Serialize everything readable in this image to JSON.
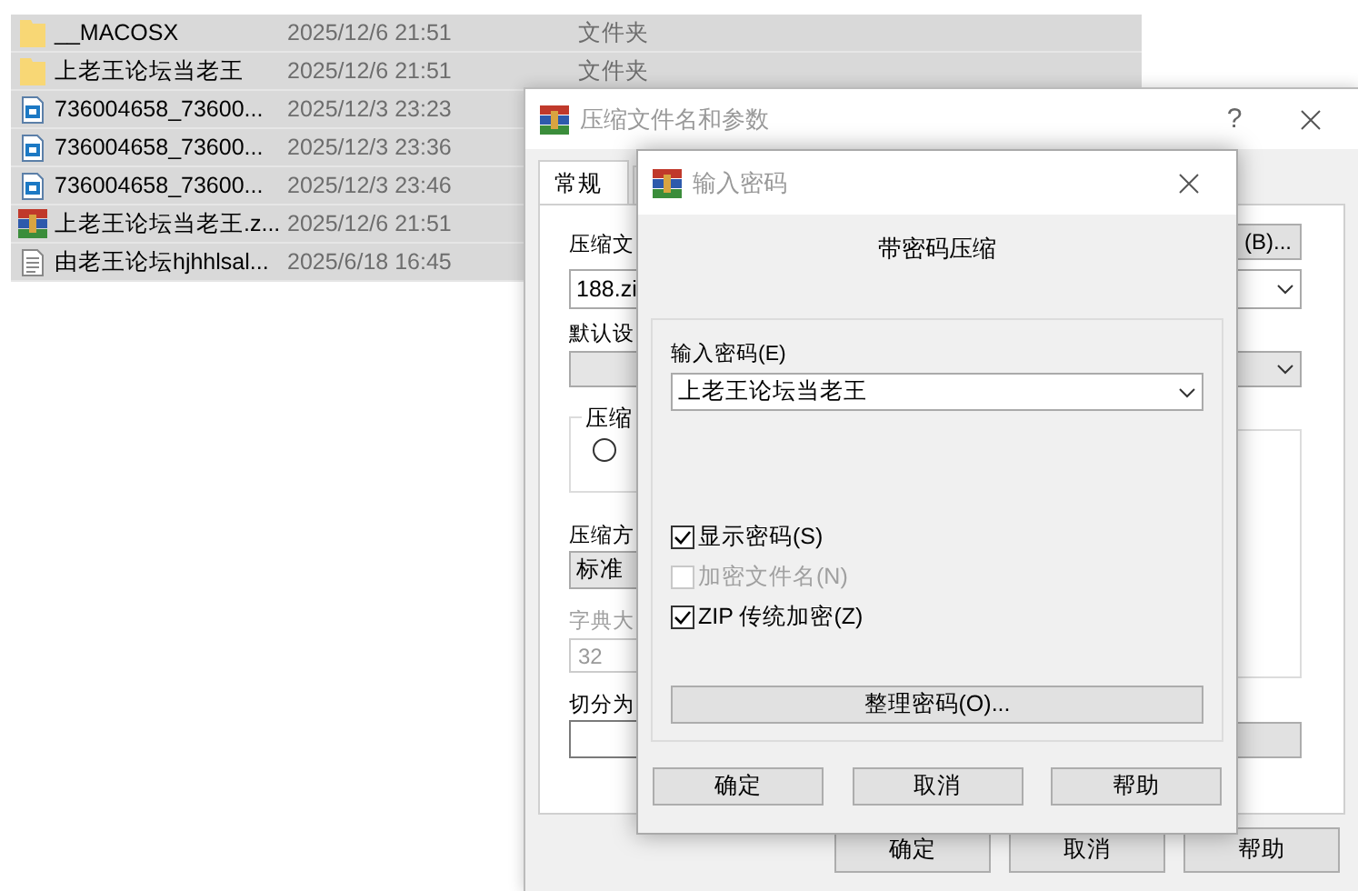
{
  "files": [
    {
      "kind": "folder",
      "name": "__MACOSX",
      "date": "2025/12/6 21:51",
      "type": "文件夹"
    },
    {
      "kind": "folder",
      "name": "上老王论坛当老王",
      "date": "2025/12/6 21:51",
      "type": "文件夹"
    },
    {
      "kind": "document",
      "name": "736004658_73600...",
      "date": "2025/12/3 23:23"
    },
    {
      "kind": "document",
      "name": "736004658_73600...",
      "date": "2025/12/3 23:36"
    },
    {
      "kind": "document",
      "name": "736004658_73600...",
      "date": "2025/12/3 23:46"
    },
    {
      "kind": "archive",
      "name": "上老王论坛当老王.z...",
      "date": "2025/12/6 21:51"
    },
    {
      "kind": "text",
      "name": "由老王论坛hjhhlsal...",
      "date": "2025/6/18 16:45"
    }
  ],
  "archive_dialog": {
    "title": "压缩文件名和参数",
    "help": "?",
    "tabs": [
      {
        "label": "常规",
        "selected": true
      },
      {
        "selected": false
      }
    ],
    "archive_name_label": "压缩文",
    "browse_button": "(B)...",
    "archive_name": "188.zi",
    "profile_label": "默认设",
    "format_group": {
      "legend": "压缩",
      "radio": {
        "selected": false
      }
    },
    "method_label": "压缩方",
    "method": "标准",
    "dictionary": {
      "label": "字典大",
      "value": "32",
      "disabled": true
    },
    "split_label": "切分为",
    "buttons": [
      "确定",
      "取消",
      "帮助"
    ]
  },
  "password_dialog": {
    "title": "输入密码",
    "heading": "带密码压缩",
    "password_label": "输入密码(E)",
    "password": "上老王论坛当老王",
    "options": [
      {
        "label": "显示密码(S)",
        "checked": true,
        "disabled": false
      },
      {
        "label": "加密文件名(N)",
        "checked": false,
        "disabled": true
      },
      {
        "label": "ZIP 传统加密(Z)",
        "checked": true,
        "disabled": false
      }
    ],
    "organize_button": "整理密码(O)...",
    "buttons": [
      "确定",
      "取消",
      "帮助"
    ]
  }
}
